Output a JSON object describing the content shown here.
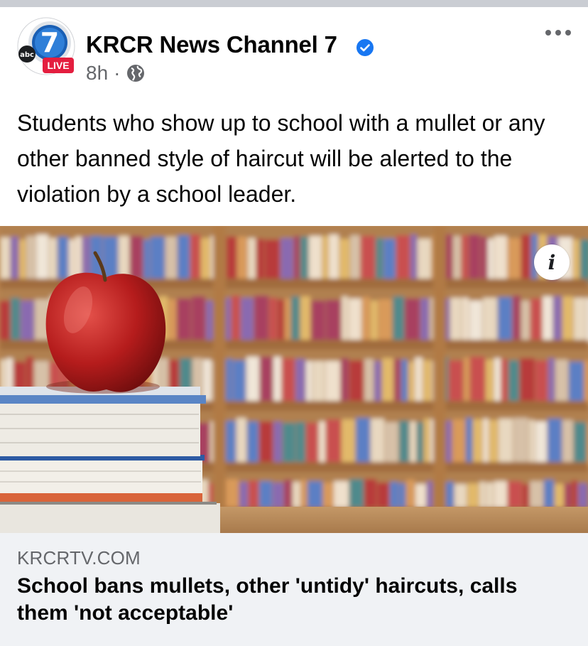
{
  "post": {
    "page_name": "KRCR News Channel 7",
    "avatar_logo_text": "abc",
    "avatar_number": "7",
    "live_badge": "LIVE",
    "time": "8h",
    "separator": "·",
    "audience_icon": "globe-icon",
    "verified_icon": "verified-badge-icon",
    "more_icon": "more-options-icon",
    "text": "Students who show up to school with a mullet or any other banned style of haircut will be alerted to the violation by a school leader."
  },
  "media": {
    "description_icon": "apple-on-books-bookshelf-image",
    "info_label": "i"
  },
  "link": {
    "domain": "KRCRTV.COM",
    "title": "School bans mullets, other 'untidy' haircuts, calls them 'not acceptable'"
  },
  "colors": {
    "verified_blue": "#1877f2",
    "live_red": "#e41e3f",
    "secondary_text": "#65676b",
    "card_bg": "#f0f2f5"
  }
}
